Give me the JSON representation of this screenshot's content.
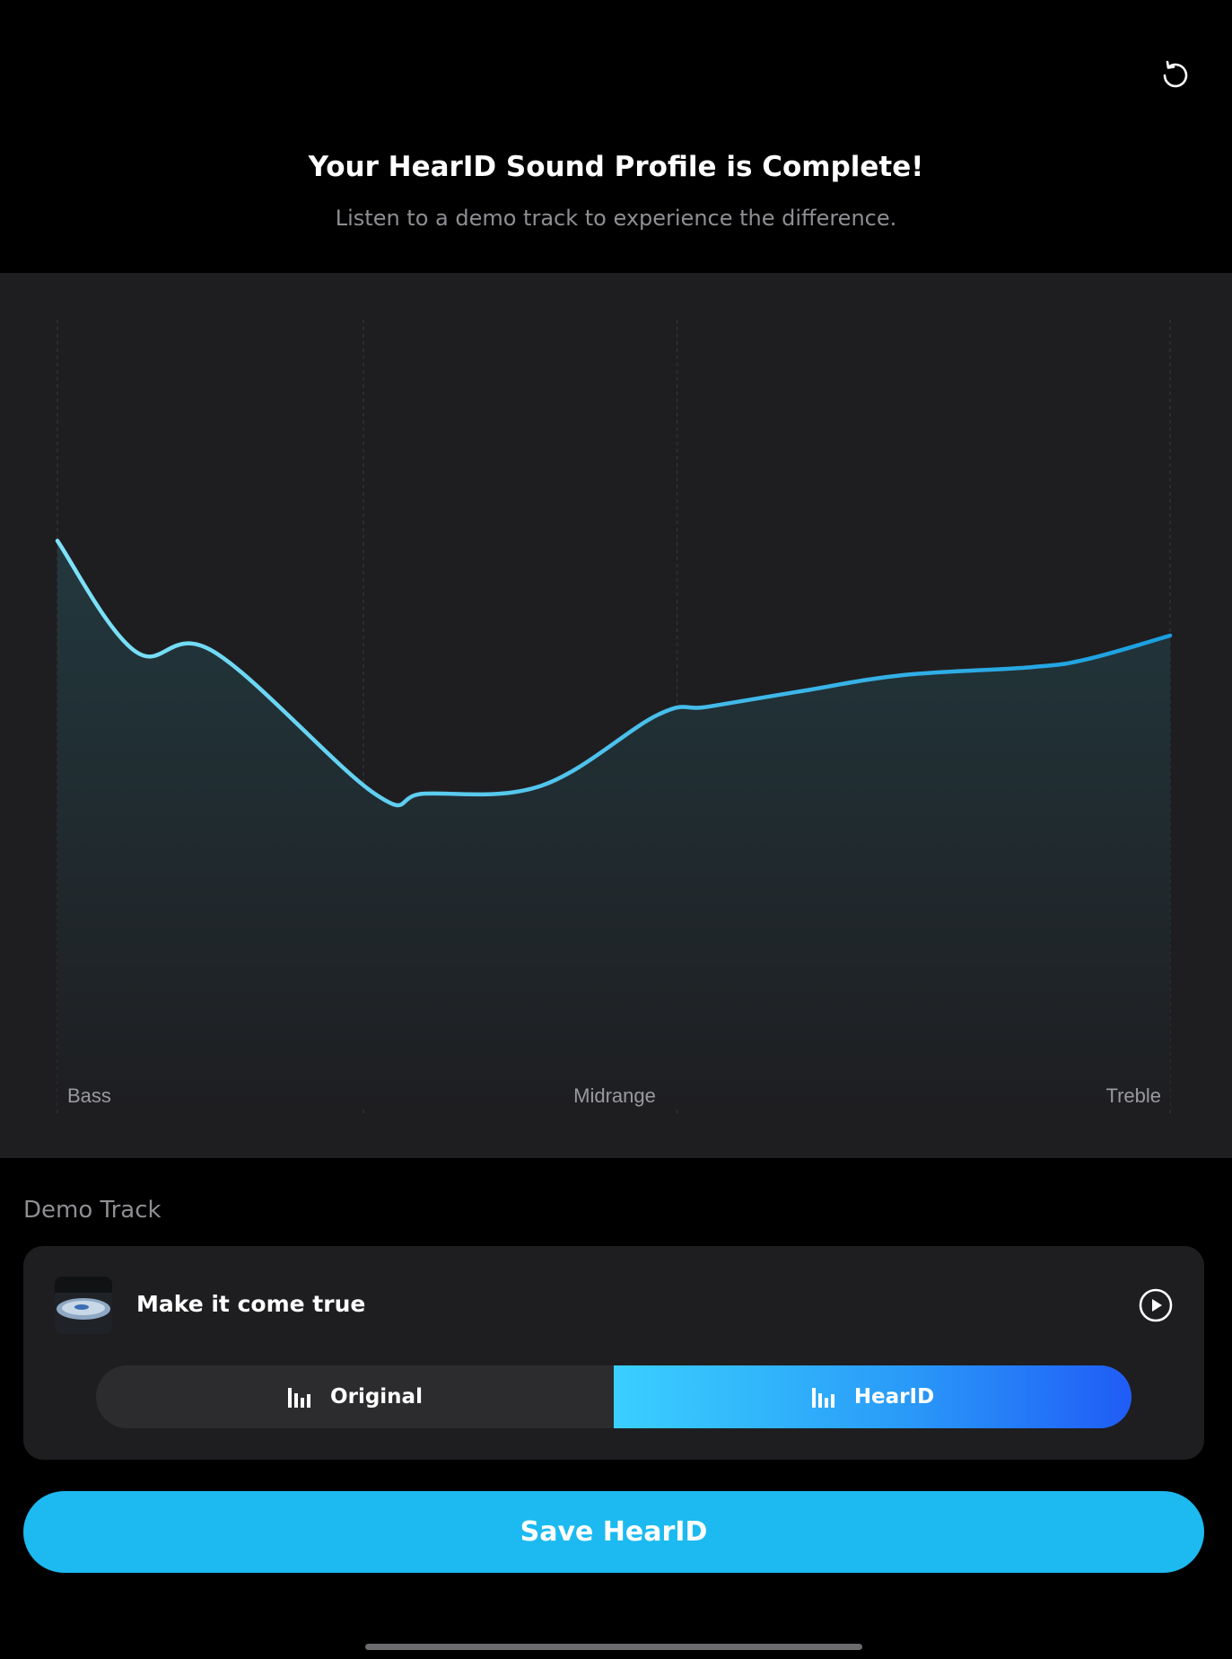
{
  "header": {
    "title": "Your HearID Sound Profile is Complete!",
    "subtitle": "Listen to a demo track to experience the difference.",
    "reset_icon": "reset-icon"
  },
  "chart_data": {
    "type": "area",
    "x_labels": [
      "Bass",
      "Midrange",
      "Treble"
    ],
    "line_colors": [
      "#7ee3f8",
      "#1a9fe0"
    ],
    "description_free": true,
    "points": [
      [
        0.0,
        0.72
      ],
      [
        0.07,
        0.58
      ],
      [
        0.14,
        0.58
      ],
      [
        0.285,
        0.4
      ],
      [
        0.33,
        0.4
      ],
      [
        0.435,
        0.41
      ],
      [
        0.54,
        0.5
      ],
      [
        0.585,
        0.51
      ],
      [
        0.67,
        0.53
      ],
      [
        0.76,
        0.55
      ],
      [
        0.875,
        0.56
      ],
      [
        0.925,
        0.57
      ],
      [
        1.0,
        0.6
      ]
    ]
  },
  "demo": {
    "section_label": "Demo Track",
    "track_name": "Make it come true",
    "play_icon": "play-icon",
    "toggle": {
      "original_label": "Original",
      "hearid_label": "HearID",
      "selected": "HearID"
    }
  },
  "save_label": "Save HearID",
  "colors": {
    "accent": "#1cbaf0",
    "panel": "#1e1e21",
    "background": "#000000"
  }
}
